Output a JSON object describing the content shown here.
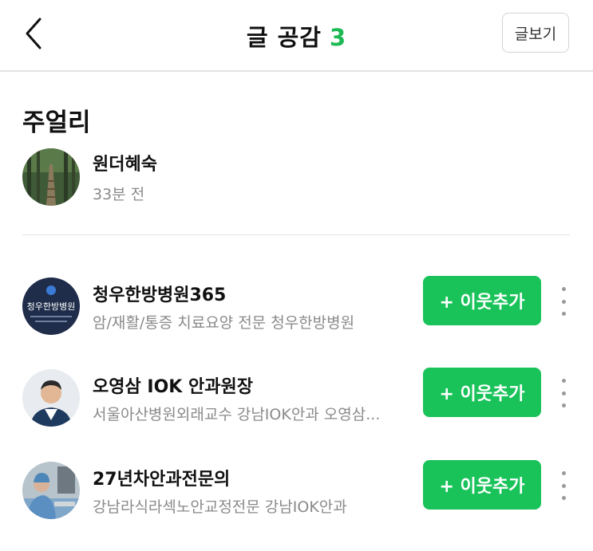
{
  "header": {
    "title": "글 공감",
    "count": "3",
    "view_button": "글보기"
  },
  "post": {
    "section_title": "주얼리",
    "author": {
      "name": "원더혜숙",
      "time": "33분 전"
    }
  },
  "likers": [
    {
      "name": "청우한방병원365",
      "desc": "암/재활/통증 치료요양 전문 청우한방병원",
      "avatar_text": "청우한방병원",
      "follow_label": "+ 이웃추가"
    },
    {
      "name": "오영삼 IOK 안과원장",
      "desc": "서울아산병원외래교수 강남IOK안과 오영삼...",
      "follow_label": "+ 이웃추가"
    },
    {
      "name": "27년차안과전문의",
      "desc": "강남라식라섹노안교정전문 강남IOK안과",
      "follow_label": "+ 이웃추가"
    }
  ],
  "colors": {
    "accent": "#19c35a",
    "count": "#1db954"
  }
}
